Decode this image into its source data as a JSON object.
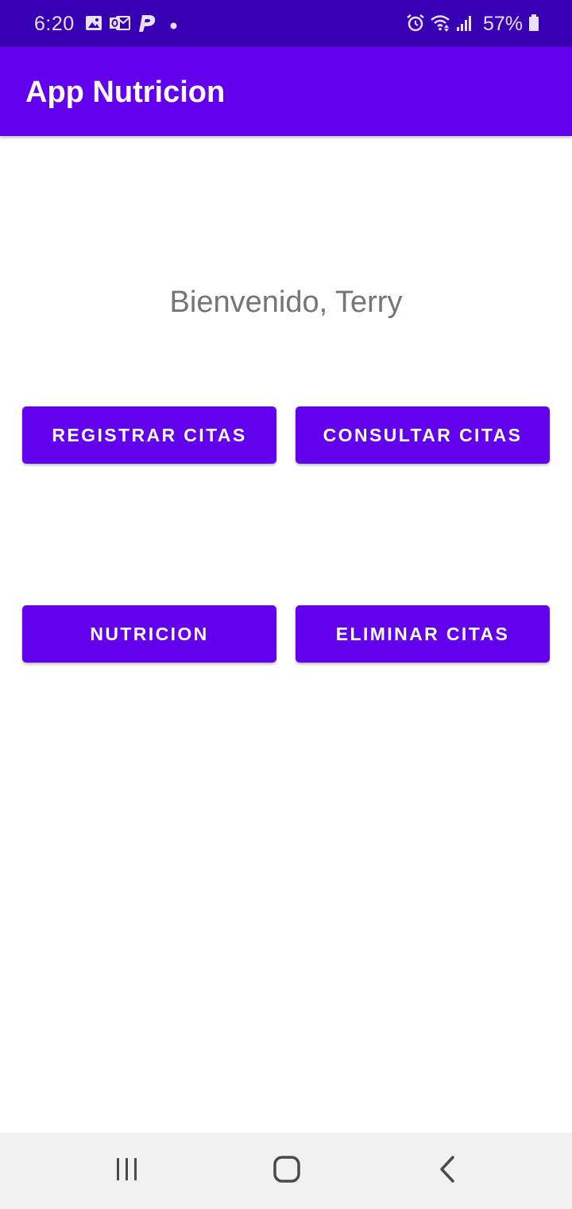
{
  "status_bar": {
    "time": "6:20",
    "battery_percent": "57%",
    "background_color": "#3700b3",
    "icons_left": [
      "gallery-icon",
      "outlook-icon",
      "paypal-icon",
      "notification-dot-icon"
    ],
    "icons_right": [
      "alarm-icon",
      "wifi-icon",
      "signal-icon",
      "battery-icon"
    ]
  },
  "app_bar": {
    "title": "App Nutricion",
    "background_color": "#6200ee"
  },
  "main": {
    "welcome_text": "Bienvenido, Terry",
    "buttons": {
      "registrar": "REGISTRAR CITAS",
      "consultar": "CONSULTAR CITAS",
      "nutricion": "NUTRICION",
      "eliminar": "ELIMINAR CITAS"
    },
    "button_color": "#6200ee"
  },
  "nav_bar": {
    "icons": [
      "recent-apps-icon",
      "home-icon",
      "back-icon"
    ]
  }
}
